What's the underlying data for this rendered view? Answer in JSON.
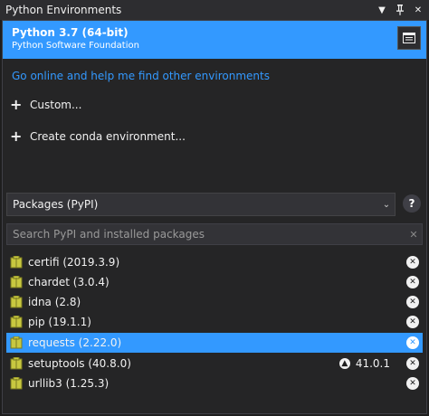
{
  "window": {
    "title": "Python Environments",
    "menu_icon": "dropdown-arrow-icon",
    "pin_icon": "pin-icon",
    "close_icon": "close-icon"
  },
  "selected_env": {
    "name": "Python 3.7 (64-bit)",
    "publisher": "Python Software Foundation",
    "icon": "environment-icon"
  },
  "find_link": "Go online and help me find other environments",
  "actions": [
    {
      "label": "Custom...",
      "icon": "plus-icon"
    },
    {
      "label": "Create conda environment...",
      "icon": "plus-icon"
    }
  ],
  "view_select": {
    "value": "Packages (PyPI)",
    "icon": "chevron-down-icon"
  },
  "help_label": "?",
  "search": {
    "placeholder": "Search PyPI and installed packages",
    "clear_icon": "clear-icon"
  },
  "packages": [
    {
      "label": "certifi (2019.3.9)",
      "selected": false,
      "update": ""
    },
    {
      "label": "chardet (3.0.4)",
      "selected": false,
      "update": ""
    },
    {
      "label": "idna (2.8)",
      "selected": false,
      "update": ""
    },
    {
      "label": "pip (19.1.1)",
      "selected": false,
      "update": ""
    },
    {
      "label": "requests (2.22.0)",
      "selected": true,
      "update": ""
    },
    {
      "label": "setuptools (40.8.0)",
      "selected": false,
      "update": "41.0.1"
    },
    {
      "label": "urllib3 (1.25.3)",
      "selected": false,
      "update": ""
    }
  ],
  "colors": {
    "accent": "#3399ff",
    "background": "#252526",
    "text": "#f1f1f1",
    "package_icon": "#c8c840"
  }
}
